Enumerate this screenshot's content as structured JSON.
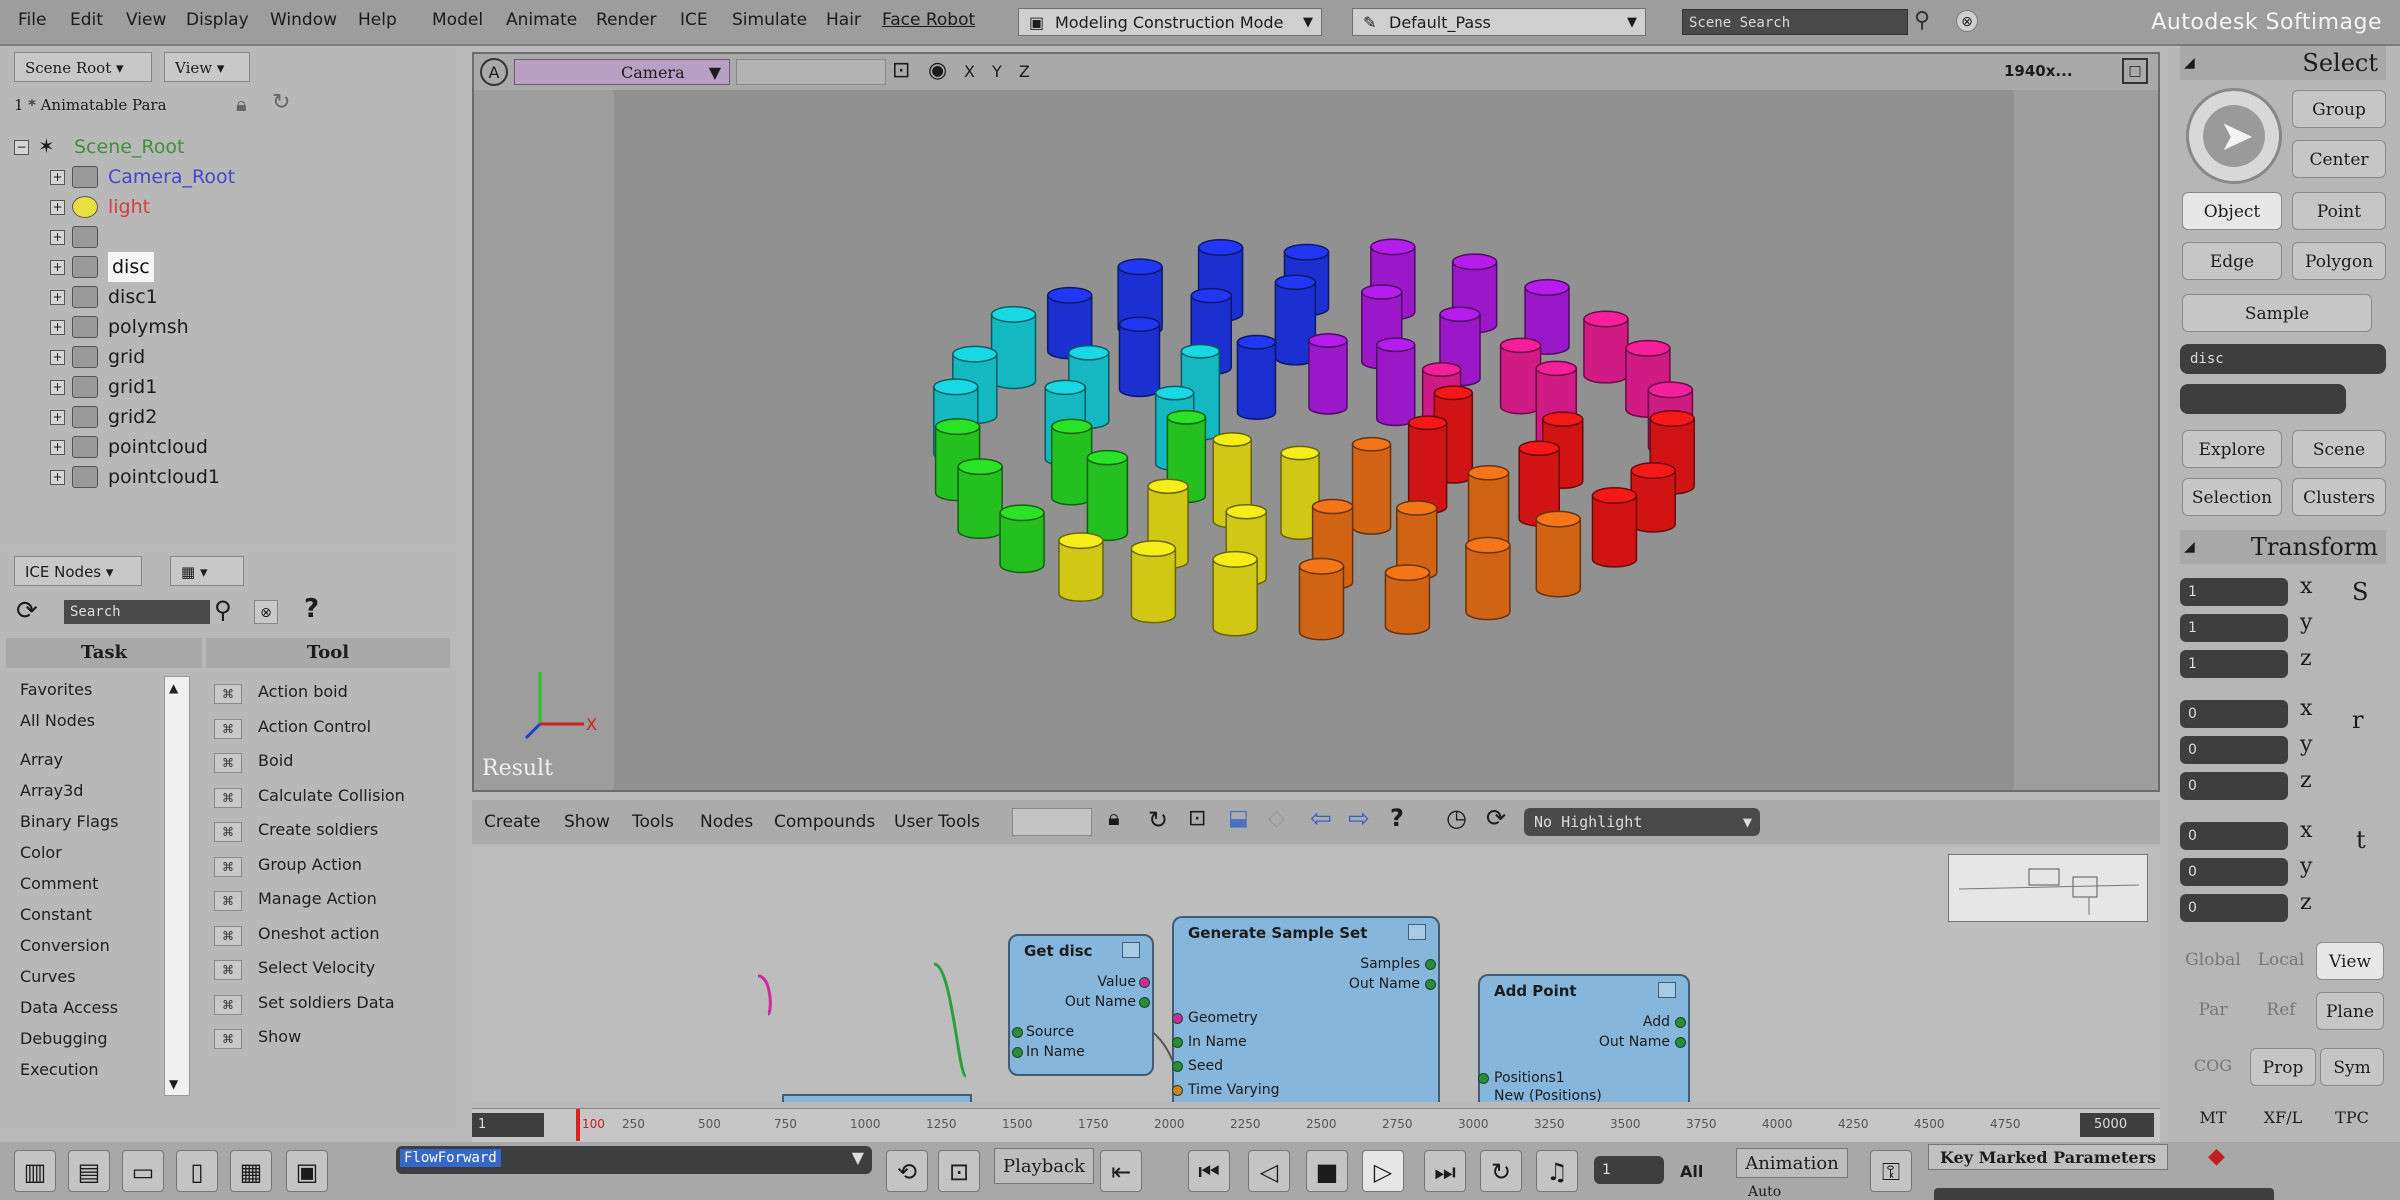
{
  "menubar": {
    "items": [
      "File",
      "Edit",
      "View",
      "Display",
      "Window",
      "Help",
      "Model",
      "Animate",
      "Render",
      "ICE",
      "Simulate",
      "Hair",
      "Face Robot"
    ],
    "mode": "Modeling Construction Mode",
    "pass": "Default_Pass",
    "search": "Scene Search",
    "brand": "Autodesk Softimage"
  },
  "explorer": {
    "scope_label": "Scene Root",
    "view_label": "View",
    "filter_label": "1 * Animatable Para",
    "items": [
      {
        "label": "Scene_Root",
        "color": "#3f8f3f"
      },
      {
        "label": "Camera_Root",
        "color": "#4646c8"
      },
      {
        "label": "light",
        "color": "#d04040"
      },
      {
        "label": "",
        "color": "#c8c040"
      },
      {
        "label": "disc",
        "color": "#ffffff"
      },
      {
        "label": "disc1",
        "color": "#1c1c1c"
      },
      {
        "label": "polymsh",
        "color": "#1c1c1c"
      },
      {
        "label": "grid",
        "color": "#1c1c1c"
      },
      {
        "label": "grid1",
        "color": "#1c1c1c"
      },
      {
        "label": "grid2",
        "color": "#1c1c1c"
      },
      {
        "label": "pointcloud",
        "color": "#1c1c1c"
      },
      {
        "label": "pointcloud1",
        "color": "#1c1c1c"
      }
    ]
  },
  "ice": {
    "dropdown": "ICE Nodes",
    "search": "Search",
    "tabs": [
      "Task",
      "Tool"
    ],
    "tasks": [
      "Favorites",
      "All Nodes",
      "Array",
      "Array3d",
      "Binary Flags",
      "Color",
      "Comment",
      "Constant",
      "Conversion",
      "Curves",
      "Data Access",
      "Debugging",
      "Execution"
    ],
    "tools": [
      "Action boid",
      "Action Control",
      "Boid",
      "Calculate Collision",
      "Create soldiers",
      "Group Action",
      "Manage Action",
      "Oneshot action",
      "Select Velocity",
      "Set soldiers Data",
      "Show"
    ]
  },
  "viewport": {
    "camera": "Camera",
    "axes_label": "X Y Z",
    "resolution": "1940x...",
    "result_label": "Result",
    "colors": {
      "blue": "#1c2fd0",
      "magenta": "#d01a84",
      "red": "#d01414",
      "orange": "#d06414",
      "yellow": "#d0c814",
      "green": "#24c020",
      "cyan": "#14b8c0",
      "purple": "#9a18c8"
    }
  },
  "nodeeditor": {
    "menus": [
      "Create",
      "Show",
      "Tools",
      "Nodes",
      "Compounds",
      "User Tools"
    ],
    "highlight": "No Highlight",
    "nodes": [
      {
        "title": "Get disc",
        "ports_out": [
          "Value",
          "Out Name"
        ],
        "ports_in": [
          "Source",
          "In Name"
        ]
      },
      {
        "title": "Generate Sample Set",
        "ports_out": [
          "Samples",
          "Out Name"
        ],
        "ports_in": [
          "Geometry",
          "In Name",
          "Seed",
          "Time Varying"
        ]
      },
      {
        "title": "Add Point",
        "ports_out": [
          "Add",
          "Out Name"
        ],
        "ports_in": [
          "Positions1",
          "New (Positions)"
        ]
      }
    ]
  },
  "rightpanel": {
    "select_title": "Select",
    "buttons": [
      "Group",
      "Center",
      "Object",
      "Point",
      "Edge",
      "Polygon",
      "Sample"
    ],
    "filter_value": "disc",
    "explore": [
      "Explore",
      "Scene",
      "Selection",
      "Clusters"
    ],
    "transform_title": "Transform",
    "scale": [
      "1",
      "1",
      "1"
    ],
    "rotate": [
      "0",
      "0",
      "0"
    ],
    "translate": [
      "0",
      "0",
      "0"
    ],
    "axes": [
      "x",
      "y",
      "z"
    ],
    "space": [
      "Global",
      "Local",
      "View"
    ],
    "ref": [
      "Par",
      "Ref",
      "Plane"
    ],
    "cog": [
      "COG",
      "Prop",
      "Sym"
    ],
    "bottom": [
      "MT",
      "XF/L",
      "TPC"
    ]
  },
  "timeline": {
    "start": "1",
    "end": "5000",
    "current": "100",
    "ticks": [
      "250",
      "500",
      "750",
      "1000",
      "1250",
      "1500",
      "1750",
      "2000",
      "2250",
      "2500",
      "2750",
      "3000",
      "3250",
      "3500",
      "3750",
      "4000",
      "4250",
      "4500",
      "4750"
    ]
  },
  "bottombar": {
    "mcp_field": "FlowForward",
    "playback": "Playback",
    "frame_field": "1",
    "all_label": "All",
    "animation": "Animation",
    "key_marked": "Key Marked Parameters",
    "auto_label": "Auto"
  }
}
